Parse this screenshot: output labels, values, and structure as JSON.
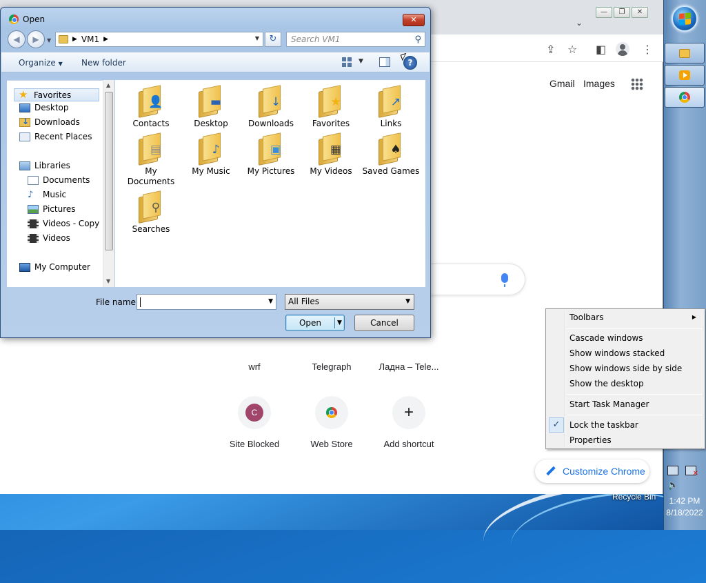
{
  "desktop": {
    "recycle_bin_label": "Recycle Bin"
  },
  "taskbar": {
    "clock_time": "1:42 PM",
    "clock_date": "8/18/2022",
    "buttons": [
      {
        "name": "explorer",
        "icon": "folder-icon"
      },
      {
        "name": "media-player",
        "icon": "media-player-icon"
      },
      {
        "name": "chrome",
        "icon": "chrome-icon"
      }
    ]
  },
  "chrome": {
    "header_links": {
      "gmail": "Gmail",
      "images": "Images"
    },
    "shortcuts": [
      {
        "label": "wrf"
      },
      {
        "label": "Telegraph"
      },
      {
        "label": "Ладна – Tele..."
      },
      {
        "label": "Site Blocked",
        "letter": "C"
      },
      {
        "label": "Web Store"
      },
      {
        "label": "Add shortcut"
      }
    ],
    "customize_label": "Customize Chrome"
  },
  "dialog": {
    "title": "Open",
    "address_path": "VM1",
    "search_placeholder": "Search VM1",
    "organize_label": "Organize",
    "new_folder_label": "New folder",
    "nav_items": [
      {
        "label": "Favorites"
      },
      {
        "label": "Desktop"
      },
      {
        "label": "Downloads"
      },
      {
        "label": "Recent Places"
      },
      {
        "label": "Libraries"
      },
      {
        "label": "Documents"
      },
      {
        "label": "Music"
      },
      {
        "label": "Pictures"
      },
      {
        "label": "Videos - Copy"
      },
      {
        "label": "Videos"
      },
      {
        "label": "My Computer"
      }
    ],
    "folders": [
      {
        "label": "Contacts"
      },
      {
        "label": "Desktop"
      },
      {
        "label": "Downloads"
      },
      {
        "label": "Favorites"
      },
      {
        "label": "Links"
      },
      {
        "label": "My Documents"
      },
      {
        "label": "My Music"
      },
      {
        "label": "My Pictures"
      },
      {
        "label": "My Videos"
      },
      {
        "label": "Saved Games"
      },
      {
        "label": "Searches"
      }
    ],
    "file_name_label": "File name:",
    "file_name_value": "",
    "file_type_value": "All Files",
    "open_label": "Open",
    "cancel_label": "Cancel"
  },
  "context_menu": {
    "items": [
      {
        "label": "Toolbars",
        "submenu": true
      },
      {
        "label": "Cascade windows"
      },
      {
        "label": "Show windows stacked"
      },
      {
        "label": "Show windows side by side"
      },
      {
        "label": "Show the desktop"
      },
      {
        "label": "Start Task Manager"
      },
      {
        "label": "Lock the taskbar",
        "checked": true
      },
      {
        "label": "Properties"
      }
    ]
  }
}
